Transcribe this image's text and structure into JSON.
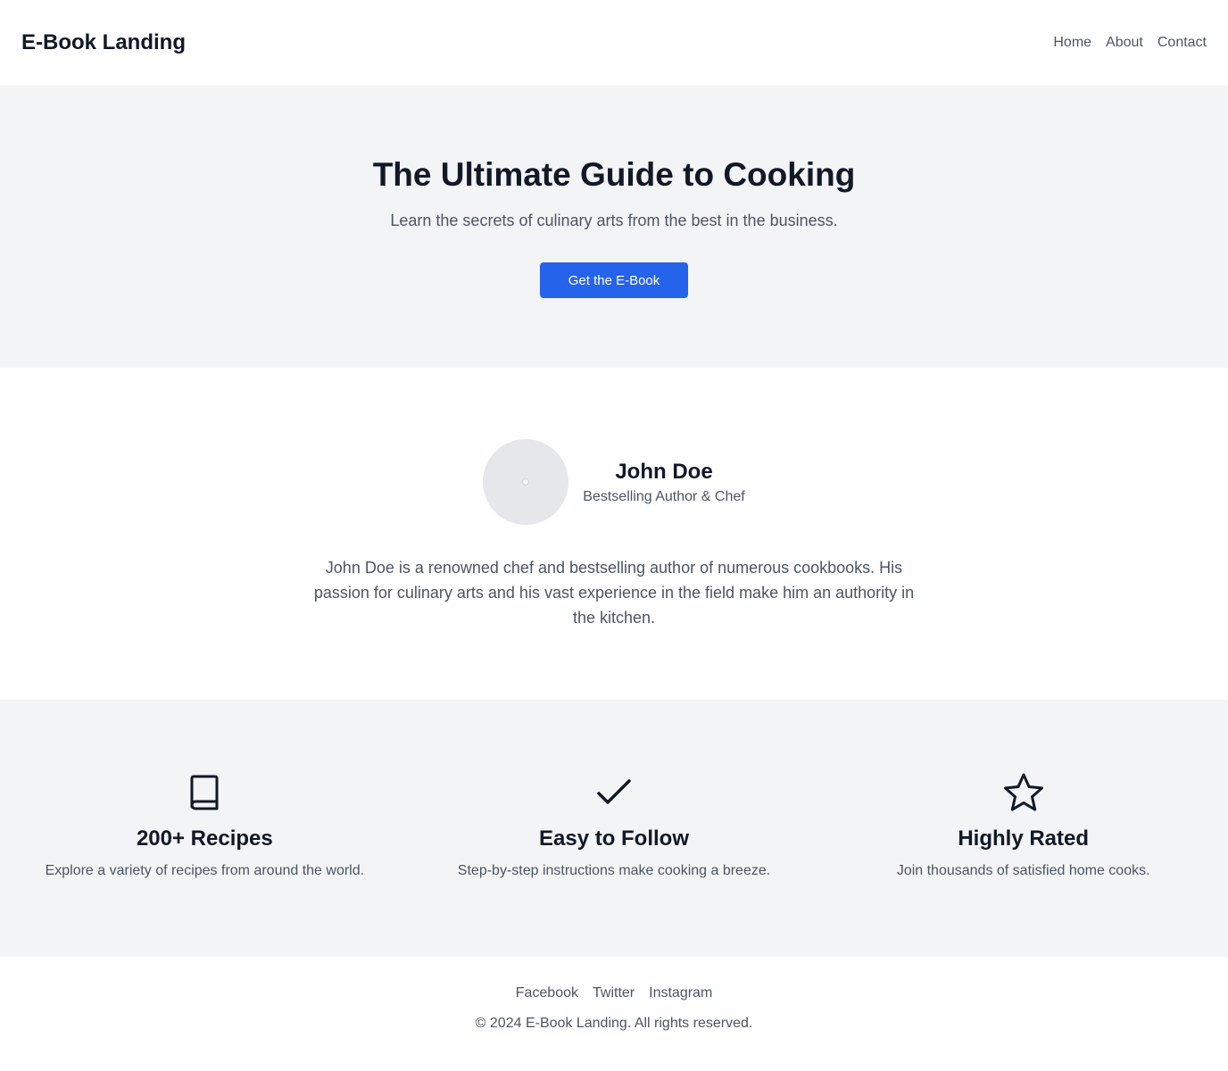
{
  "header": {
    "logo": "E-Book Landing",
    "nav": [
      "Home",
      "About",
      "Contact"
    ]
  },
  "hero": {
    "title": "The Ultimate Guide to Cooking",
    "subtitle": "Learn the secrets of culinary arts from the best in the business.",
    "cta_label": "Get the E-Book"
  },
  "about": {
    "name": "John Doe",
    "role": "Bestselling Author & Chef",
    "bio": "John Doe is a renowned chef and bestselling author of numerous cookbooks. His passion for culinary arts and his vast experience in the field make him an authority in the kitchen."
  },
  "features": [
    {
      "icon": "book-icon",
      "title": "200+ Recipes",
      "text": "Explore a variety of recipes from around the world."
    },
    {
      "icon": "check-icon",
      "title": "Easy to Follow",
      "text": "Step-by-step instructions make cooking a breeze."
    },
    {
      "icon": "star-icon",
      "title": "Highly Rated",
      "text": "Join thousands of satisfied home cooks."
    }
  ],
  "footer": {
    "social": [
      "Facebook",
      "Twitter",
      "Instagram"
    ],
    "copyright": "© 2024 E-Book Landing. All rights reserved."
  },
  "colors": {
    "accent": "#2563eb",
    "heading": "#111827",
    "body_text": "#4b5563",
    "section_bg": "#f3f4f6"
  }
}
